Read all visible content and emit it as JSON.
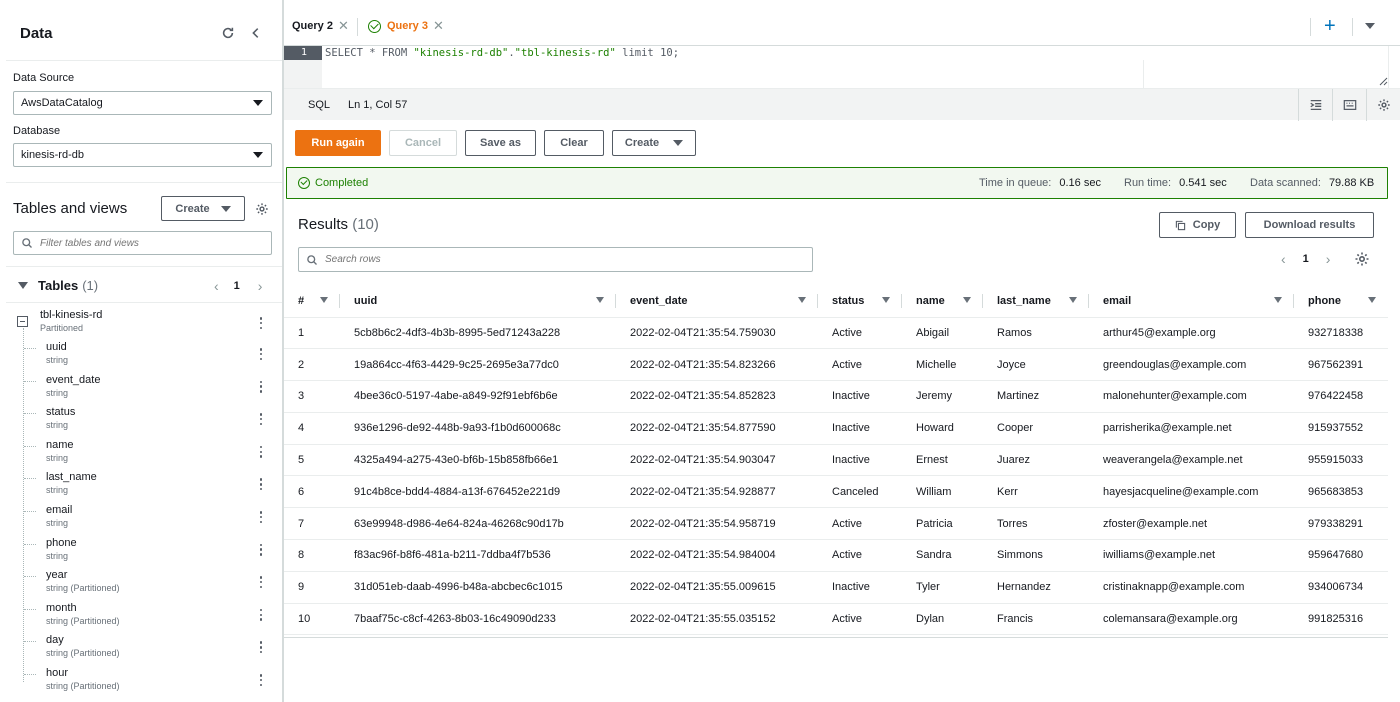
{
  "left_panel": {
    "title": "Data",
    "data_source_label": "Data Source",
    "data_source_value": "AwsDataCatalog",
    "database_label": "Database",
    "database_value": "kinesis-rd-db",
    "tables_views_title": "Tables and views",
    "create_label": "Create",
    "filter_placeholder": "Filter tables and views",
    "tables_label": "Tables",
    "tables_count": "(1)",
    "page_number": "1",
    "table": {
      "name": "tbl-kinesis-rd",
      "type": "Partitioned"
    },
    "columns": [
      {
        "name": "uuid",
        "type": "string"
      },
      {
        "name": "event_date",
        "type": "string"
      },
      {
        "name": "status",
        "type": "string"
      },
      {
        "name": "name",
        "type": "string"
      },
      {
        "name": "last_name",
        "type": "string"
      },
      {
        "name": "email",
        "type": "string"
      },
      {
        "name": "phone",
        "type": "string"
      },
      {
        "name": "year",
        "type": "string (Partitioned)"
      },
      {
        "name": "month",
        "type": "string (Partitioned)"
      },
      {
        "name": "day",
        "type": "string (Partitioned)"
      },
      {
        "name": "hour",
        "type": "string (Partitioned)"
      }
    ]
  },
  "tabs": [
    {
      "label": "Query 2",
      "active": false
    },
    {
      "label": "Query 3",
      "active": true
    }
  ],
  "editor": {
    "line_number": "1",
    "query_parts": [
      {
        "text": "SELECT * FROM ",
        "cls": "kw"
      },
      {
        "text": "\"kinesis-rd-db\"",
        "cls": "str"
      },
      {
        "text": ".",
        "cls": "kw"
      },
      {
        "text": "\"tbl-kinesis-rd\"",
        "cls": "str"
      },
      {
        "text": " limit 10;",
        "cls": "kw"
      }
    ],
    "language": "SQL",
    "cursor_position": "Ln 1, Col 57"
  },
  "actions": {
    "run_again": "Run again",
    "cancel": "Cancel",
    "save_as": "Save as",
    "clear": "Clear",
    "create": "Create"
  },
  "status": {
    "text": "Completed",
    "time_in_queue_label": "Time in queue:",
    "time_in_queue": "0.16 sec",
    "run_time_label": "Run time:",
    "run_time": "0.541 sec",
    "data_scanned_label": "Data scanned:",
    "data_scanned": "79.88 KB"
  },
  "results": {
    "title": "Results",
    "count": "(10)",
    "copy_label": "Copy",
    "download_label": "Download results",
    "search_placeholder": "Search rows",
    "page_number": "1",
    "columns": [
      "#",
      "uuid",
      "event_date",
      "status",
      "name",
      "last_name",
      "email",
      "phone"
    ],
    "rows": [
      [
        "1",
        "5cb8b6c2-4df3-4b3b-8995-5ed71243a228",
        "2022-02-04T21:35:54.759030",
        "Active",
        "Abigail",
        "Ramos",
        "arthur45@example.org",
        "932718338"
      ],
      [
        "2",
        "19a864cc-4f63-4429-9c25-2695e3a77dc0",
        "2022-02-04T21:35:54.823266",
        "Active",
        "Michelle",
        "Joyce",
        "greendouglas@example.com",
        "967562391"
      ],
      [
        "3",
        "4bee36c0-5197-4abe-a849-92f91ebf6b6e",
        "2022-02-04T21:35:54.852823",
        "Inactive",
        "Jeremy",
        "Martinez",
        "malonehunter@example.com",
        "976422458"
      ],
      [
        "4",
        "936e1296-de92-448b-9a93-f1b0d600068c",
        "2022-02-04T21:35:54.877590",
        "Inactive",
        "Howard",
        "Cooper",
        "parrisherika@example.net",
        "915937552"
      ],
      [
        "5",
        "4325a494-a275-43e0-bf6b-15b858fb66e1",
        "2022-02-04T21:35:54.903047",
        "Inactive",
        "Ernest",
        "Juarez",
        "weaverangela@example.net",
        "955915033"
      ],
      [
        "6",
        "91c4b8ce-bdd4-4884-a13f-676452e221d9",
        "2022-02-04T21:35:54.928877",
        "Canceled",
        "William",
        "Kerr",
        "hayesjacqueline@example.com",
        "965683853"
      ],
      [
        "7",
        "63e99948-d986-4e64-824a-46268c90d17b",
        "2022-02-04T21:35:54.958719",
        "Active",
        "Patricia",
        "Torres",
        "zfoster@example.net",
        "979338291"
      ],
      [
        "8",
        "f83ac96f-b8f6-481a-b211-7ddba4f7b536",
        "2022-02-04T21:35:54.984004",
        "Active",
        "Sandra",
        "Simmons",
        "iwilliams@example.net",
        "959647680"
      ],
      [
        "9",
        "31d051eb-daab-4996-b48a-abcbec6c1015",
        "2022-02-04T21:35:55.009615",
        "Inactive",
        "Tyler",
        "Hernandez",
        "cristinaknapp@example.com",
        "934006734"
      ],
      [
        "10",
        "7baaf75c-c8cf-4263-8b03-16c49090d233",
        "2022-02-04T21:35:55.035152",
        "Active",
        "Dylan",
        "Francis",
        "colemansara@example.org",
        "991825316"
      ]
    ]
  },
  "colors": {
    "accent": "#ec7211",
    "success": "#1d8102",
    "link": "#0073bb"
  }
}
